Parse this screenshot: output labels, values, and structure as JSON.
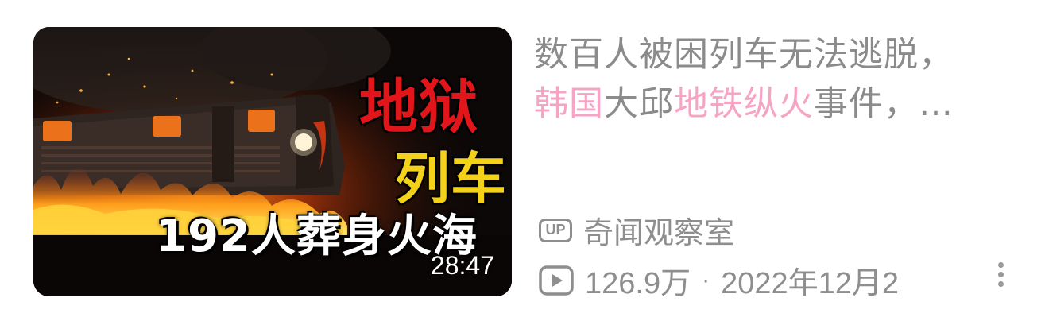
{
  "video": {
    "thumbnail": {
      "line1": "地狱",
      "line2": "列车",
      "line3": "192人葬身火海",
      "duration": "28:47"
    },
    "title": {
      "part1": "数百人被困列车无法逃脱，",
      "part2": "韩国",
      "part3": "大邱",
      "part4": "地铁纵火",
      "part5": "事件，…"
    },
    "author": {
      "badge": "UP",
      "name": "奇闻观察室"
    },
    "stats": {
      "views": "126.9万",
      "separator": "·",
      "date": "2022年12月2"
    },
    "highlight_color": "#f6a3c4",
    "text_color": "#8b8b8b"
  },
  "icons": {
    "up_badge": "up-badge-icon",
    "play": "play-count-icon",
    "more": "more-vertical-icon"
  }
}
